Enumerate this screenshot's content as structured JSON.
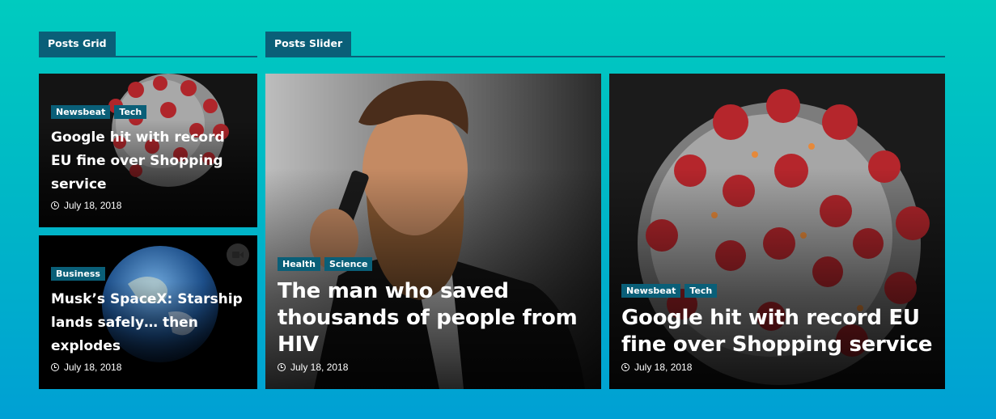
{
  "sections": {
    "grid_label": "Posts Grid",
    "slider_label": "Posts Slider"
  },
  "grid_posts": [
    {
      "badges": [
        "Newsbeat",
        "Tech"
      ],
      "title": "Google hit with record EU fine over Shopping service",
      "date": "July 18, 2018",
      "image": "virus"
    },
    {
      "badges": [
        "Business"
      ],
      "title": "Musk’s SpaceX: Starship lands safely… then explodes",
      "date": "July 18, 2018",
      "image": "earth",
      "video": true
    }
  ],
  "slider_posts": [
    {
      "badges": [
        "Health",
        "Science"
      ],
      "title": "The man who saved thousands of people from HIV",
      "date": "July 18, 2018",
      "image": "bearded-man-phone"
    },
    {
      "badges": [
        "Newsbeat",
        "Tech"
      ],
      "title": "Google hit with record EU fine over Shopping service",
      "date": "July 18, 2018",
      "image": "virus"
    }
  ],
  "colors": {
    "accent": "#0a5f78",
    "bg_top": "#00cbbf",
    "bg_bottom": "#00a0d4"
  }
}
